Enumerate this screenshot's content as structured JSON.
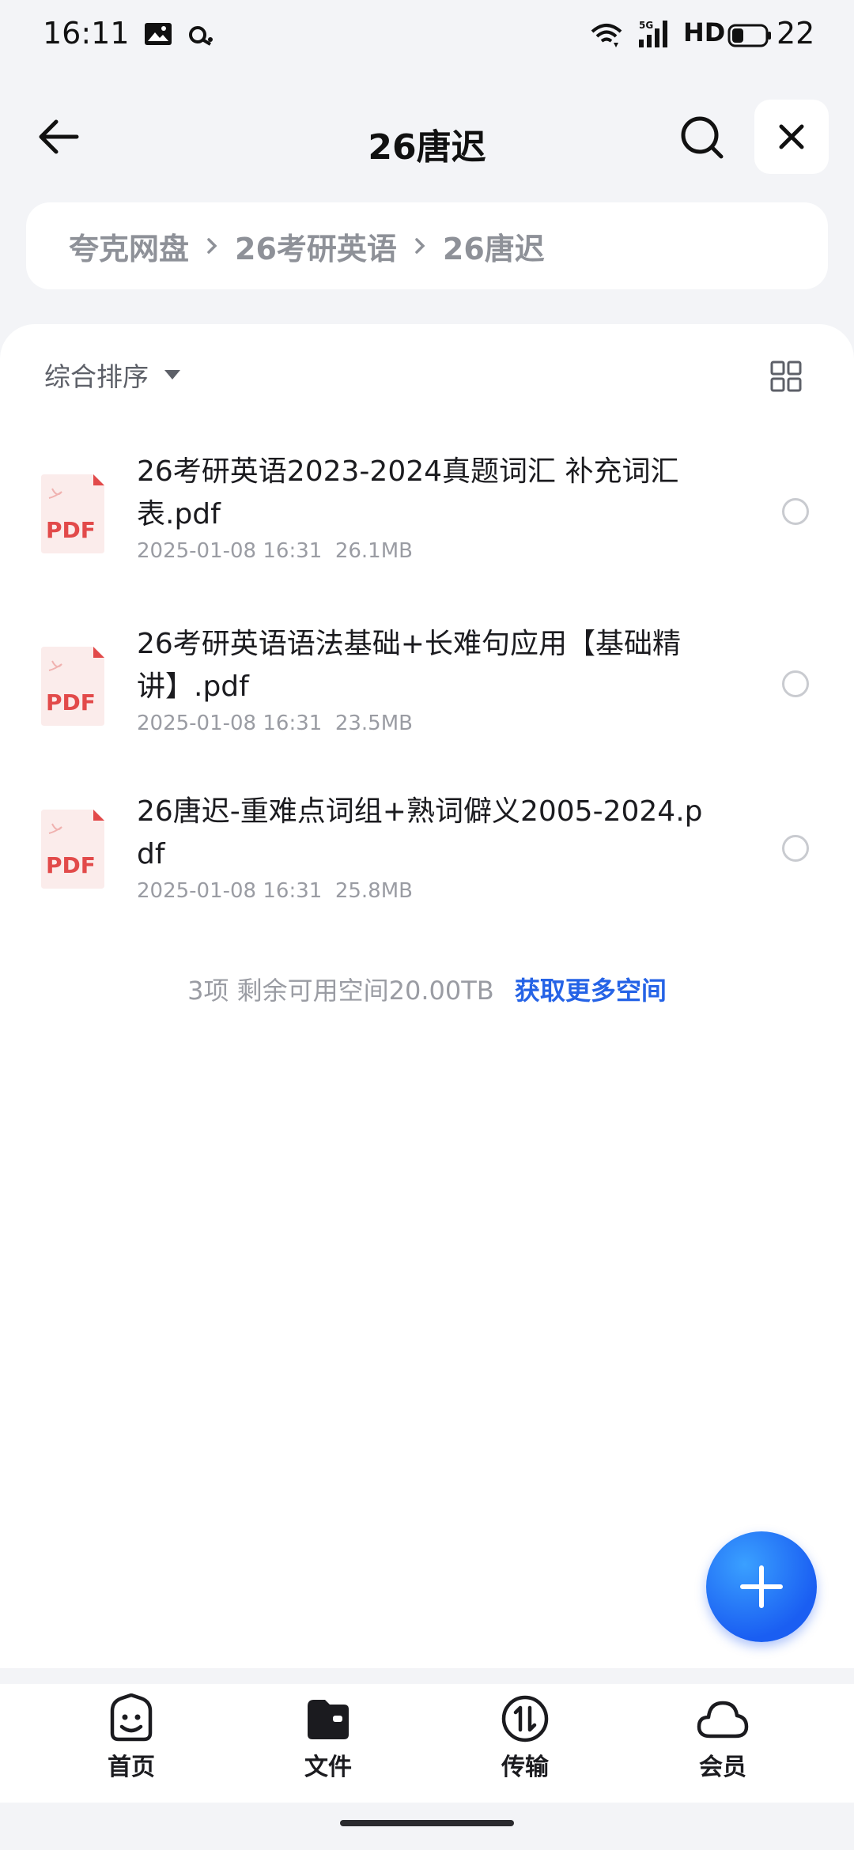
{
  "status_bar": {
    "time": "16:11",
    "network": "5G",
    "hd": "HD",
    "battery": "22"
  },
  "header": {
    "title": "26唐迟"
  },
  "breadcrumb": [
    "夸克网盘",
    "26考研英语",
    "26唐迟"
  ],
  "toolbar": {
    "sort_label": "综合排序"
  },
  "files": [
    {
      "name": "26考研英语2023-2024真题词汇 补充词汇表.pdf",
      "date": "2025-01-08 16:31",
      "size": "26.1MB",
      "icon": "pdf-icon"
    },
    {
      "name": "26考研英语语法基础+长难句应用【基础精讲】.pdf",
      "date": "2025-01-08 16:31",
      "size": "23.5MB",
      "icon": "pdf-icon"
    },
    {
      "name": "26唐迟-重难点词组+熟词僻义2005-2024.pdf",
      "date": "2025-01-08 16:31",
      "size": "25.8MB",
      "icon": "pdf-icon"
    }
  ],
  "footer": {
    "summary": "3项 剩余可用空间20.00TB",
    "link": "获取更多空间"
  },
  "nav": {
    "items": [
      {
        "label": "首页",
        "icon": "home-smile-icon"
      },
      {
        "label": "文件",
        "icon": "folder-icon"
      },
      {
        "label": "传输",
        "icon": "transfer-icon"
      },
      {
        "label": "会员",
        "icon": "cloud-icon"
      }
    ]
  },
  "colors": {
    "accent": "#2563e6",
    "pdf_red": "#e24a4a",
    "page_bg": "#f3f4f7"
  }
}
